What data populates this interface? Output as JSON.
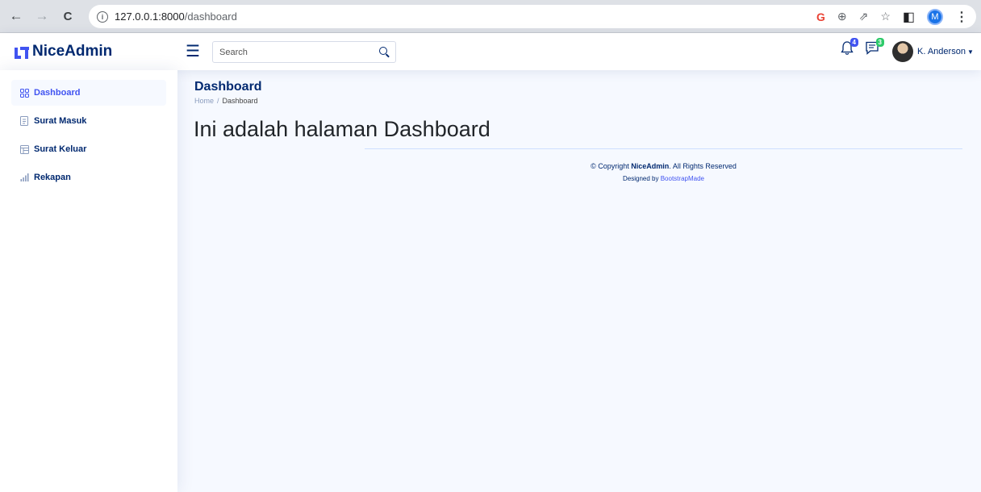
{
  "browser": {
    "back_icon": "←",
    "forward_icon": "→",
    "reload_icon": "C",
    "url_host": "127.0.0.1:8000",
    "url_path": "/dashboard",
    "google_icon": "G",
    "zoom_icon": "⊕",
    "share_icon": "⇗",
    "star_icon": "☆",
    "sidepanel_icon": "◧",
    "profile_initial": "M",
    "menu_icon": "⋮"
  },
  "header": {
    "logo_text": "NiceAdmin",
    "search_placeholder": "Search",
    "notifications_count": "4",
    "messages_count": "3",
    "notifications_color": "#4154f1",
    "messages_color": "#2eca6a",
    "profile_name": "K. Anderson"
  },
  "sidebar": {
    "items": [
      {
        "label": "Dashboard",
        "icon": "grid-icon",
        "active": true
      },
      {
        "label": "Surat Masuk",
        "icon": "document-icon",
        "active": false
      },
      {
        "label": "Surat Keluar",
        "icon": "layout-icon",
        "active": false
      },
      {
        "label": "Rekapan",
        "icon": "bar-chart-icon",
        "active": false
      }
    ]
  },
  "main": {
    "page_title": "Dashboard",
    "breadcrumb": {
      "home": "Home",
      "separator": "/",
      "current": "Dashboard"
    },
    "heading": "Ini adalah halaman Dashboard"
  },
  "footer": {
    "copyright_prefix": "© Copyright ",
    "brand": "NiceAdmin",
    "copyright_suffix": ". All Rights Reserved",
    "designed_by": "Designed by ",
    "designer_link": "BootstrapMade"
  },
  "colors": {
    "accent": "#4154f1",
    "navy": "#012970",
    "background": "#f6f9ff"
  }
}
